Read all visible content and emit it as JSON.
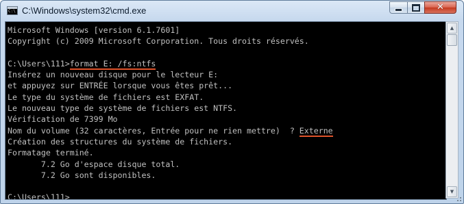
{
  "window": {
    "title": "C:\\Windows\\system32\\cmd.exe",
    "app_icon_text": "C:\\",
    "close_glyph": "✕"
  },
  "console": {
    "lines": [
      "Microsoft Windows [version 6.1.7601]",
      "Copyright (c) 2009 Microsoft Corporation. Tous droits réservés.",
      "",
      {
        "prompt": "C:\\Users\\111>",
        "input": "format E: /fs:ntfs"
      },
      "Insérez un nouveau disque pour le lecteur E:",
      "et appuyez sur ENTRÉE lorsque vous êtes prêt...",
      "Le type du système de fichiers est EXFAT.",
      "Le nouveau type de système de fichiers est NTFS.",
      "Vérification de 7399 Mo",
      {
        "prompt": "Nom du volume (32 caractères, Entrée pour ne rien mettre)  ? ",
        "input": "Externe"
      },
      "Création des structures du système de fichiers.",
      "Formatage terminé.",
      "       7.2 Go d'espace disque total.",
      "       7.2 Go sont disponibles.",
      "",
      {
        "prompt": "C:\\Users\\111>",
        "input": ""
      }
    ],
    "colors": {
      "background": "#000000",
      "text": "#c0c0c0",
      "annotation_underline": "#e0532a"
    }
  },
  "scrollbar": {
    "up_arrow": "▲",
    "down_arrow": "▼"
  }
}
